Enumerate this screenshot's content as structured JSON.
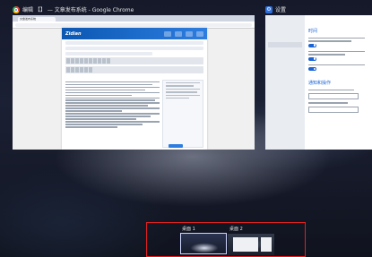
{
  "windows": [
    {
      "id": "chrome",
      "title": "编辑 【】 — 文章发布系统 - Google Chrome",
      "icon": "chrome-icon",
      "tab_title": "文章发布系统",
      "url": "",
      "site_logo": "Zidian"
    },
    {
      "id": "settings",
      "title": "设置",
      "icon": "gear-icon",
      "section_headings": [
        "时间",
        "通知和操作"
      ]
    }
  ],
  "virtual_desktops": {
    "items": [
      {
        "label": "桌面 1",
        "active": true
      },
      {
        "label": "桌面 2",
        "active": false
      }
    ],
    "highlight_color": "#e21f1f"
  }
}
